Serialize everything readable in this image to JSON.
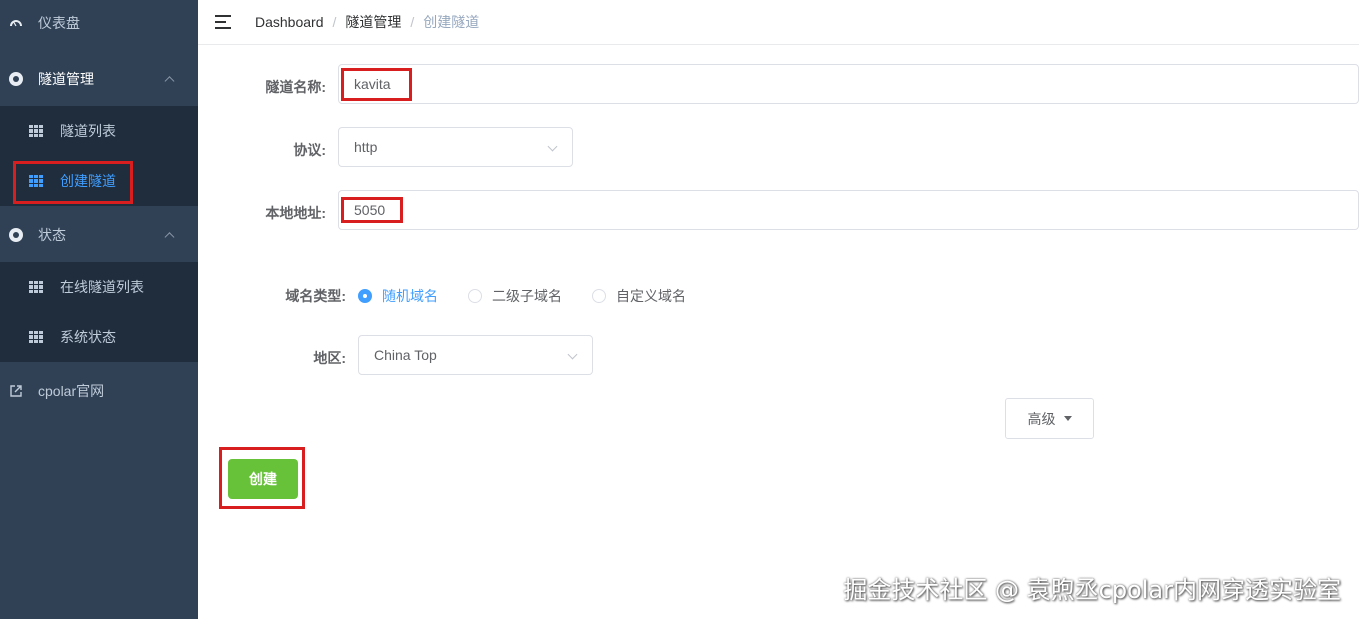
{
  "sidebar": {
    "items": [
      {
        "label": "仪表盘",
        "icon": "dashboard-icon"
      },
      {
        "label": "隧道管理",
        "icon": "tunnel-icon"
      },
      {
        "label": "隧道列表",
        "icon": "table-icon"
      },
      {
        "label": "创建隧道",
        "icon": "table-icon"
      },
      {
        "label": "状态",
        "icon": "status-icon"
      },
      {
        "label": "在线隧道列表",
        "icon": "table-icon"
      },
      {
        "label": "系统状态",
        "icon": "table-icon"
      },
      {
        "label": "cpolar官网",
        "icon": "external-link-icon"
      }
    ]
  },
  "header": {
    "breadcrumb": [
      "Dashboard",
      "隧道管理",
      "创建隧道"
    ]
  },
  "form": {
    "name_label": "隧道名称:",
    "name_value": "kavita",
    "protocol_label": "协议:",
    "protocol_value": "http",
    "local_label": "本地地址:",
    "local_value": "5050",
    "domain_type_label": "域名类型:",
    "domain_options": [
      "随机域名",
      "二级子域名",
      "自定义域名"
    ],
    "region_label": "地区:",
    "region_value": "China Top",
    "advanced_label": "高级",
    "create_label": "创建"
  },
  "watermark": "掘金技术社区 @ 袁煦丞cpolar内网穿透实验室",
  "colors": {
    "sidebar_bg": "#304156",
    "submenu_bg": "#1f2d3d",
    "accent": "#409eff",
    "create_button": "#67c23a",
    "highlight_box": "#d81e1e"
  }
}
